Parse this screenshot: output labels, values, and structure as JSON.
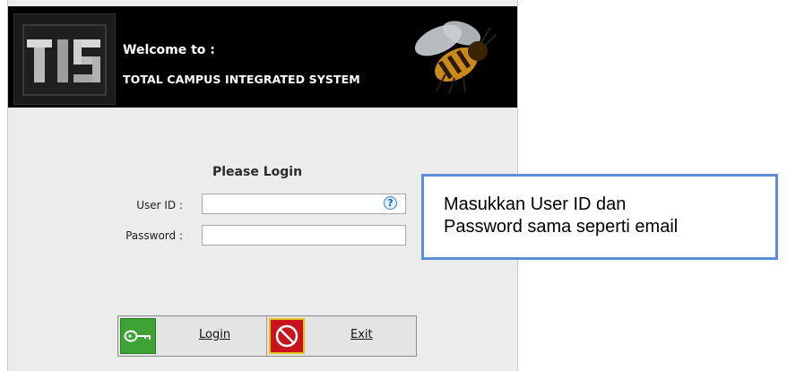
{
  "header": {
    "welcome": "Welcome to :",
    "system_name": "TOTAL CAMPUS INTEGRATED SYSTEM"
  },
  "login": {
    "title": "Please Login",
    "user_id_label": "User ID :",
    "password_label": "Password :",
    "user_id_value": "",
    "password_value": "",
    "help_symbol": "?"
  },
  "buttons": {
    "login_label": "Login",
    "exit_label": "Exit"
  },
  "callout": {
    "line1": "Masukkan User ID dan",
    "line2": "Password sama seperti email"
  },
  "colors": {
    "header_bg": "#000000",
    "login_icon_bg": "#3ea335",
    "exit_icon_bg": "#c8131c",
    "callout_border": "#5b8ed6"
  },
  "icons": {
    "login": "key-icon",
    "exit": "no-entry-icon",
    "help": "help-icon"
  }
}
